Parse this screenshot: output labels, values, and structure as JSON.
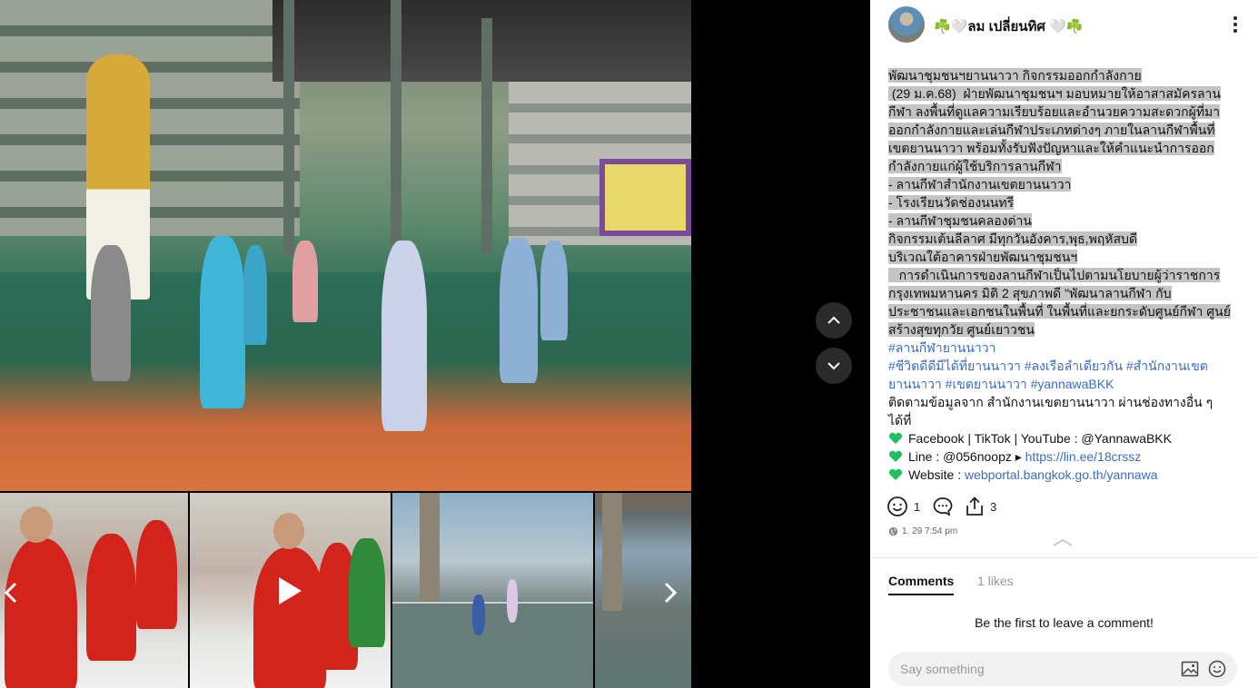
{
  "post": {
    "author": "☘️🤍ลม เปลี่ยนทิศ 🤍☘️",
    "highlighted_lines": [
      "พัฒนาชุมชนฯยานนาวา กิจกรรมออกกำลังกาย",
      " (29 ม.ค.68)  ฝ่ายพัฒนาชุมชนฯ มอบหมายให้อาสาสมัครลาน",
      "กีฬา ลงพื้นที่ดูแลความเรียบร้อยและอำนวยความสะดวกผู้ที่มา",
      "ออกกำลังกายและเล่นกีฬาประเภทต่างๆ ภายในลานกีฬาพื้นที่",
      "เขตยานนาวา พร้อมทั้งรับฟังปัญหาและให้คำแนะนำการออก",
      "กำลังกายแก่ผู้ใช้บริการลานกีฬา",
      "- ลานกีฬาสำนักงานเขตยานนาวา",
      "- โรงเรียนวัดช่องนนทรี",
      "- ลานกีฬาชุมชนคลองด่าน",
      "กิจกรรมเต้นลีลาศ มีทุกวันอังคาร,พุธ,พฤหัสบดี",
      "บริเวณใต้อาคารฝ่ายพัฒนาชุมชนฯ",
      "   การดำเนินการของลานกีฬาเป็นไปตามนโยบายผู้ว่าราชการ",
      "กรุงเทพมหานคร  มิติ 2 สุขภาพดี  \"พัฒนาลานกีฬา กับ",
      "ประชาชนและเอกชนในพื้นที่ ในพื้นที่และยกระดับศูนย์กีฬา ศูนย์",
      "สร้างสุขทุกวัย ศูนย์เยาวชน"
    ],
    "hashtags": [
      "#ลานกีฬายานนาวา",
      "#ชีวิตดีดีมีได้ที่ยานนาวา #ลงเรือลำเดียวกัน #สำนักงานเขต",
      "ยานนาวา #เขตยานนาวา #yannawaBKK"
    ],
    "follow_lines": [
      "ติดตามข้อมูลจาก สำนักงานเขตยานนาวา ผ่านช่องทางอื่น ๆ",
      "ได้ที่"
    ],
    "contacts": [
      {
        "label": "Facebook | TikTok | YouTube : @YannawaBKK",
        "link": ""
      },
      {
        "label": "Line : @056noopz ▸ ",
        "link": "https://lin.ee/18crssz"
      },
      {
        "label": "Website : ",
        "link": "webportal.bangkok.go.th/yannawa"
      }
    ],
    "reaction_count": "1",
    "comment_count": "",
    "share_count": "3",
    "timestamp": "1. 29 7:54 pm"
  },
  "tabs": {
    "comments": "Comments",
    "likes": "1 likes"
  },
  "comments": {
    "empty_text": "Be the first to leave a comment!",
    "input_placeholder": "Say something"
  },
  "icons": {
    "heart": "green-heart-icon",
    "react": "smiley-icon",
    "comment": "speech-bubble-icon",
    "share": "share-icon",
    "globe": "globe-icon",
    "image": "image-icon",
    "emoji": "emoji-icon"
  },
  "colors": {
    "hashtag": "#3a6cc2",
    "heart": "#1fbf63",
    "highlight": "#c4c4c4"
  }
}
